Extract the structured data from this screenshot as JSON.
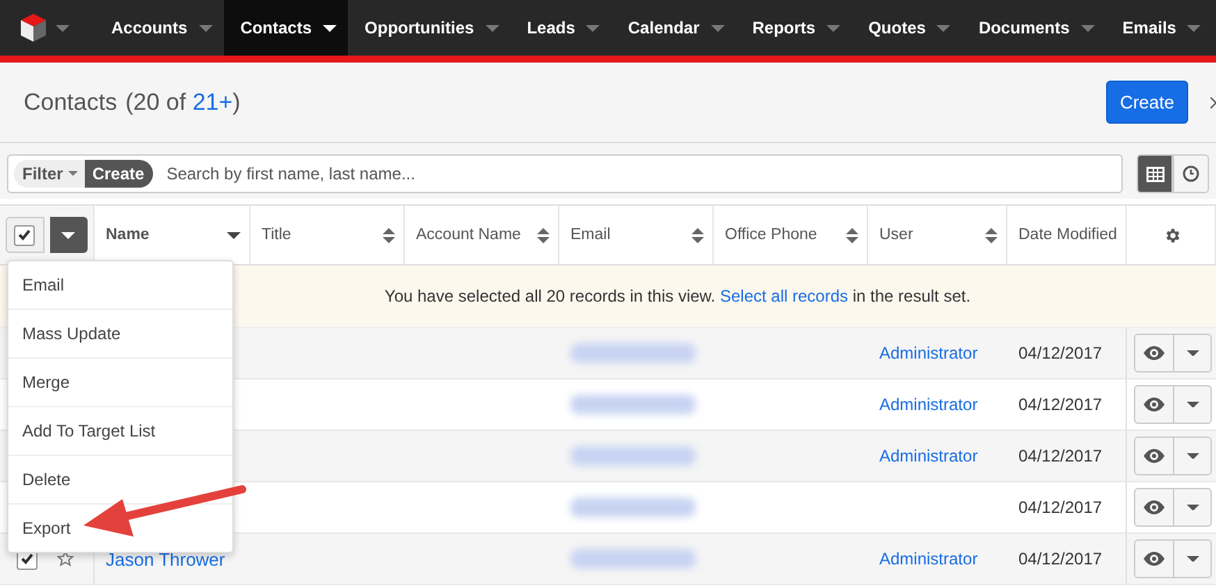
{
  "nav": {
    "items": [
      {
        "label": "Accounts",
        "selected": false
      },
      {
        "label": "Contacts",
        "selected": true
      },
      {
        "label": "Opportunities",
        "selected": false
      },
      {
        "label": "Leads",
        "selected": false
      },
      {
        "label": "Calendar",
        "selected": false
      },
      {
        "label": "Reports",
        "selected": false
      },
      {
        "label": "Quotes",
        "selected": false
      },
      {
        "label": "Documents",
        "selected": false
      },
      {
        "label": "Emails",
        "selected": false
      }
    ]
  },
  "header": {
    "title": "Contacts",
    "count": "(20 of",
    "total_link": "21+",
    "count_end": ")",
    "create_button": "Create"
  },
  "filter_bar": {
    "filter": "Filter",
    "create": "Create",
    "search": {
      "placeholder": "Search by first name, last name..."
    },
    "views": [
      {
        "kind": "list",
        "selected": true
      },
      {
        "kind": "activity",
        "selected": false
      }
    ]
  },
  "table": {
    "select_all": {
      "checked": true
    },
    "actions_menu": {
      "expanded": true,
      "items": [
        "Email",
        "Mass Update",
        "Merge",
        "Add To Target List",
        "Delete",
        "Export"
      ]
    },
    "columns": [
      {
        "label": "Name",
        "sorted": true
      },
      {
        "label": "Title",
        "sorted": false
      },
      {
        "label": "Account Name",
        "sorted": false
      },
      {
        "label": "Email",
        "sorted": false
      },
      {
        "label": "Office Phone",
        "sorted": false
      },
      {
        "label": "User",
        "sorted": false
      },
      {
        "label": "Date Modified"
      }
    ],
    "alert": {
      "before": "You have selected all 20 records in this view.",
      "link": "Select all records",
      "after": "in the result set."
    },
    "rows": [
      {
        "user": "Administrator",
        "date": "04/12/2017"
      },
      {
        "user": "Administrator",
        "date": "04/12/2017"
      },
      {
        "user": "Administrator",
        "date": "04/12/2017"
      },
      {
        "date": "04/12/2017"
      },
      {
        "checked": true,
        "name": "Jason Thrower",
        "user": "Administrator",
        "date": "04/12/2017"
      }
    ]
  }
}
